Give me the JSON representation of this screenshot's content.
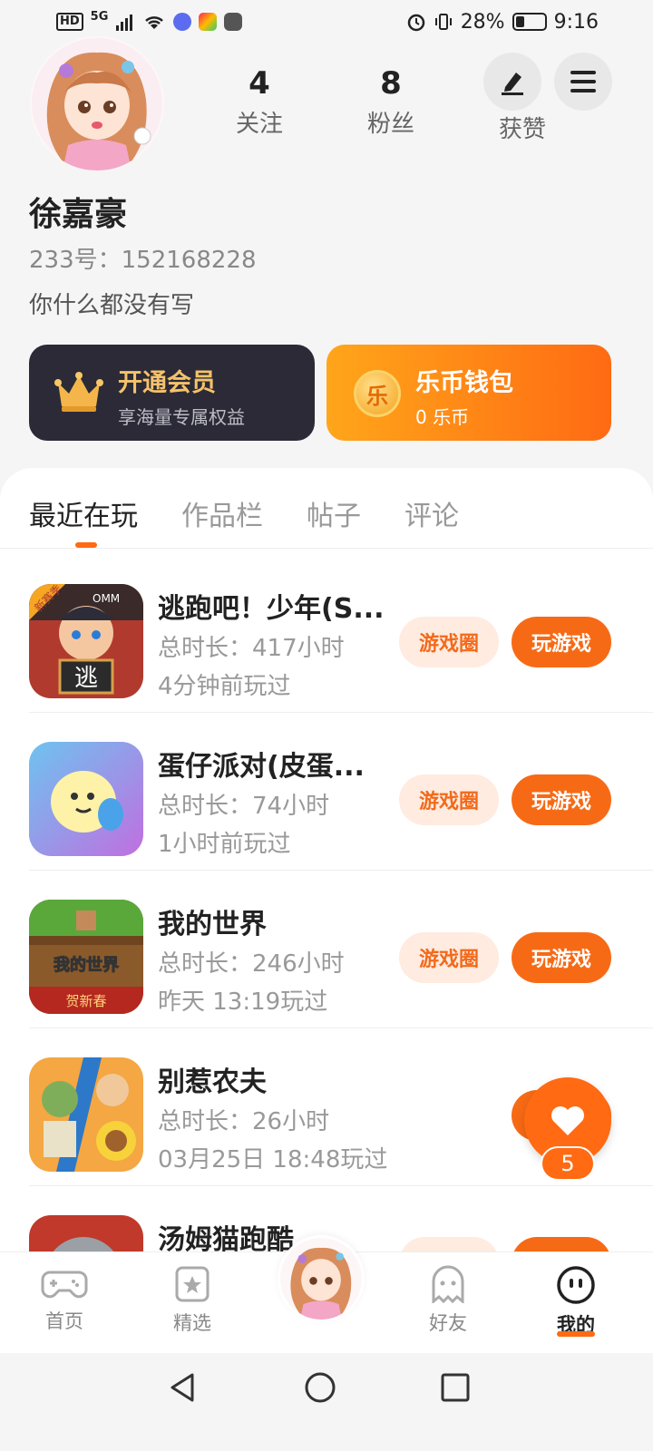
{
  "status": {
    "net_box": "HD",
    "signal": "5G",
    "battery_pct": "28%",
    "time": "9:16"
  },
  "profile": {
    "following_count": "4",
    "following_label": "关注",
    "fans_count": "8",
    "fans_label": "粉丝",
    "likes_label": "获赞",
    "name": "徐嘉豪",
    "uid": "233号：152168228",
    "bio": "你什么都没有写"
  },
  "cards": {
    "vip_title": "开通会员",
    "vip_sub": "享海量专属权益",
    "wallet_title": "乐币钱包",
    "wallet_sub": "0 乐币",
    "coin_glyph": "乐"
  },
  "tabs": [
    {
      "label": "最近在玩"
    },
    {
      "label": "作品栏"
    },
    {
      "label": "帖子"
    },
    {
      "label": "评论"
    }
  ],
  "games": [
    {
      "name": "逃跑吧！少年(S...",
      "duration": "总时长：417小时",
      "last": "4分钟前玩过",
      "icon_text": "逃",
      "badge": "新赛季",
      "top_text": "OMM",
      "colors": [
        "#c0392b",
        "#3a2a2a"
      ]
    },
    {
      "name": "蛋仔派对(皮蛋...",
      "duration": "总时长：74小时",
      "last": "1小时前玩过",
      "icon_text": "",
      "colors": [
        "#6ec3f0",
        "#c06fe0"
      ]
    },
    {
      "name": "我的世界",
      "duration": "总时长：246小时",
      "last": "昨天 13:19玩过",
      "icon_text": "我的世界",
      "sub_text": "贺新春",
      "colors": [
        "#5aa83a",
        "#8b5a2b"
      ]
    },
    {
      "name": "别惹农夫",
      "duration": "总时长：26小时",
      "last": "03月25日 18:48玩过",
      "icon_text": "",
      "colors": [
        "#f4a742",
        "#2d78c9"
      ]
    },
    {
      "name": "汤姆猫跑酷",
      "duration": "",
      "last": "",
      "icon_text": "",
      "colors": [
        "#d9826b",
        "#c0392b"
      ]
    }
  ],
  "buttons": {
    "circle": "游戏圈",
    "play": "玩游戏"
  },
  "like_count": "5",
  "nav": {
    "home": "首页",
    "featured": "精选",
    "friends": "好友",
    "mine": "我的"
  },
  "accent": "#ff6a13"
}
